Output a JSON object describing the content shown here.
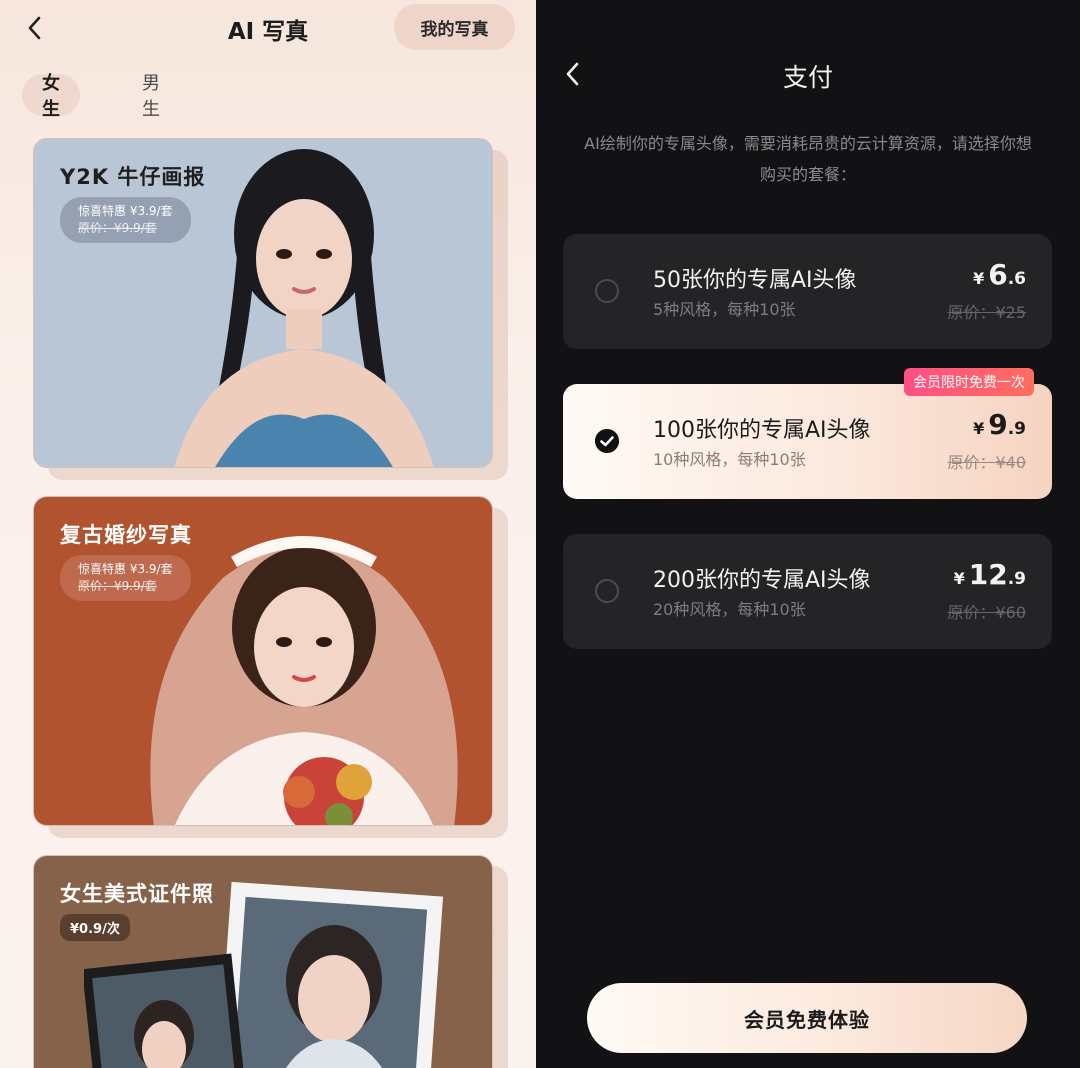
{
  "left": {
    "title": "AI 写真",
    "my_photos_label": "我的写真",
    "tabs": [
      "女生",
      "男生"
    ],
    "cards": [
      {
        "title": "Y2K 牛仔画报",
        "promo": "惊喜特惠 ¥3.9/套",
        "original": "原价：¥9.9/套"
      },
      {
        "title": "复古婚纱写真",
        "promo": "惊喜特惠 ¥3.9/套",
        "original": "原价：¥9.9/套"
      },
      {
        "title": "女生美式证件照",
        "price": "¥0.9/次"
      }
    ]
  },
  "right": {
    "title": "支付",
    "description": "AI绘制你的专属头像，需要消耗昂贵的云计算资源，请选择你想购买的套餐：",
    "plans": [
      {
        "name": "50张你的专属AI头像",
        "detail": "5种风格，每种10张",
        "currency": "¥",
        "price_int": "6",
        "price_dec": ".6",
        "original": "原价：¥25",
        "selected": false
      },
      {
        "name": "100张你的专属AI头像",
        "detail": "10种风格，每种10张",
        "currency": "¥",
        "price_int": "9",
        "price_dec": ".9",
        "original": "原价：¥40",
        "selected": true,
        "tag": "会员限时免费一次"
      },
      {
        "name": "200张你的专属AI头像",
        "detail": "20种风格，每种10张",
        "currency": "¥",
        "price_int": "12",
        "price_dec": ".9",
        "original": "原价：¥60",
        "selected": false
      }
    ],
    "cta": "会员免费体验"
  }
}
